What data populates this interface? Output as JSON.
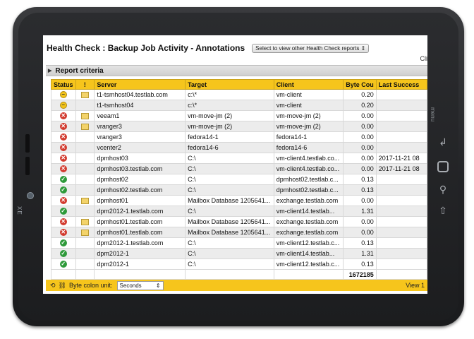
{
  "header": {
    "title": "Health Check : Backup Job Activity - Annotations",
    "report_select": "Select to view other Health Check reports",
    "corner_text": "Cli"
  },
  "criteria": {
    "label": "Report criteria"
  },
  "table": {
    "columns": [
      "Status",
      "!",
      "Server",
      "Target",
      "Client",
      "Byte Cou",
      "Last Success"
    ],
    "rows": [
      {
        "status": "warn",
        "note": true,
        "server": "t1-tsmhost04.testlab.com",
        "target": "c:\\*",
        "client": "vm-client",
        "bytes": "0.20",
        "last": ""
      },
      {
        "status": "warn",
        "note": false,
        "server": "t1-tsmhost04",
        "target": "c:\\*",
        "client": "vm-client",
        "bytes": "0.20",
        "last": ""
      },
      {
        "status": "err",
        "note": true,
        "server": "veeam1",
        "target": "vm-move-jm (2)",
        "client": "vm-move-jm (2)",
        "bytes": "0.00",
        "last": ""
      },
      {
        "status": "err",
        "note": true,
        "server": "vranger3",
        "target": "vm-move-jm (2)",
        "client": "vm-move-jm (2)",
        "bytes": "0.00",
        "last": ""
      },
      {
        "status": "err",
        "note": false,
        "server": "vranger3",
        "target": "fedora14-1",
        "client": "fedora14-1",
        "bytes": "0.00",
        "last": ""
      },
      {
        "status": "err",
        "note": false,
        "server": "vcenter2",
        "target": "fedora14-6",
        "client": "fedora14-6",
        "bytes": "0.00",
        "last": ""
      },
      {
        "status": "err",
        "note": false,
        "server": "dpmhost03",
        "target": "C:\\",
        "client": "vm-client4.testlab.co...",
        "bytes": "0.00",
        "last": "2017-11-21 08"
      },
      {
        "status": "err",
        "note": false,
        "server": "dpmhost03.testlab.com",
        "target": "C:\\",
        "client": "vm-client4.testlab.co...",
        "bytes": "0.00",
        "last": "2017-11-21 08"
      },
      {
        "status": "ok",
        "note": false,
        "server": "dpmhost02",
        "target": "C:\\",
        "client": "dpmhost02.testlab.c...",
        "bytes": "0.13",
        "last": ""
      },
      {
        "status": "ok",
        "note": false,
        "server": "dpmhost02.testlab.com",
        "target": "C:\\",
        "client": "dpmhost02.testlab.c...",
        "bytes": "0.13",
        "last": ""
      },
      {
        "status": "err",
        "note": true,
        "server": "dpmhost01",
        "target": "Mailbox Database 1205641...",
        "client": "exchange.testlab.com",
        "bytes": "0.00",
        "last": ""
      },
      {
        "status": "ok",
        "note": false,
        "server": "dpm2012-1.testlab.com",
        "target": "C:\\",
        "client": "vm-client14.testlab...",
        "bytes": "1.31",
        "last": ""
      },
      {
        "status": "err",
        "note": true,
        "server": "dpmhost01.testlab.com",
        "target": "Mailbox Database 1205641...",
        "client": "exchange.testlab.com",
        "bytes": "0.00",
        "last": ""
      },
      {
        "status": "err",
        "note": true,
        "server": "dpmhost01.testlab.com",
        "target": "Mailbox Database 1205641...",
        "client": "exchange.testlab.com",
        "bytes": "0.00",
        "last": ""
      },
      {
        "status": "ok",
        "note": false,
        "server": "dpm2012-1.testlab.com",
        "target": "C:\\",
        "client": "vm-client12.testlab.c...",
        "bytes": "0.13",
        "last": ""
      },
      {
        "status": "ok",
        "note": false,
        "server": "dpm2012-1",
        "target": "C:\\",
        "client": "vm-client14.testlab...",
        "bytes": "1.31",
        "last": ""
      },
      {
        "status": "ok",
        "note": false,
        "server": "dpm2012-1",
        "target": "C:\\",
        "client": "vm-client12.testlab.c...",
        "bytes": "0.13",
        "last": ""
      }
    ],
    "total": "1672185"
  },
  "footer": {
    "unit_label": "Byte colon unit:",
    "unit_value": "Seconds",
    "view_text": "View 1"
  },
  "device": {
    "brand": "XE",
    "menu_label": "menu"
  }
}
